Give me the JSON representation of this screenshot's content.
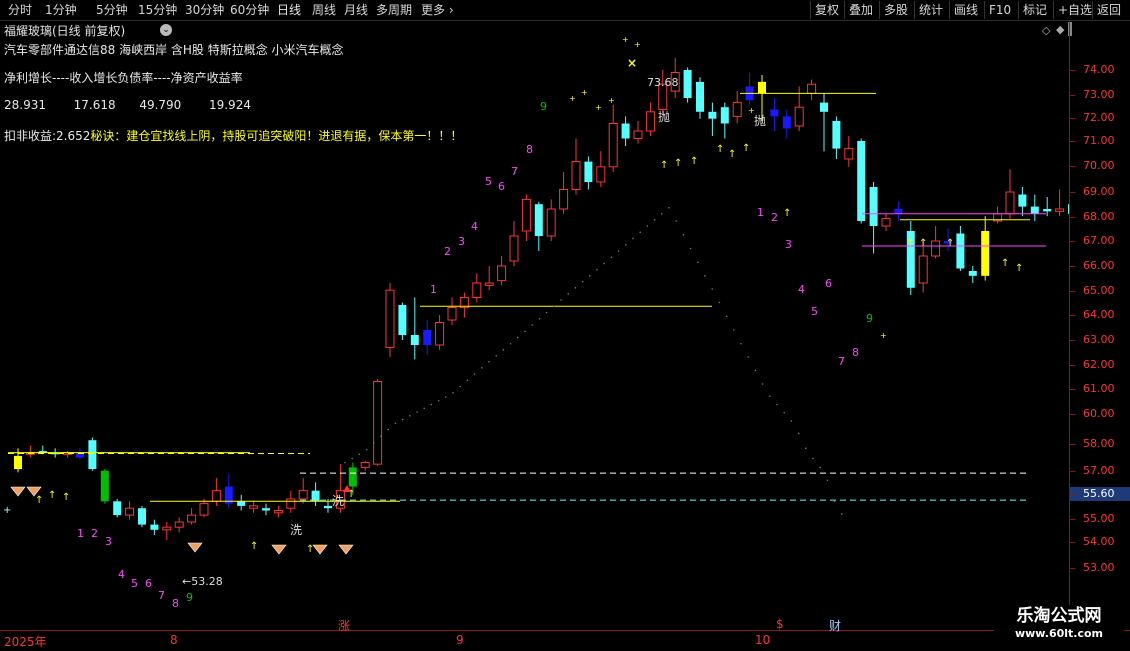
{
  "toolbar": {
    "periods": [
      "分时",
      "1分钟",
      "5分钟",
      "15分钟",
      "30分钟",
      "60分钟",
      "日线",
      "周线",
      "月线",
      "多周期",
      "更多"
    ],
    "active_period": "日线",
    "right_buttons": [
      "复权",
      "叠加",
      "多股",
      "统计",
      "画线",
      "F10",
      "标记",
      "+自选",
      "返回"
    ]
  },
  "header": {
    "title": "福耀玻璃(日线 前复权)",
    "concepts": "汽车零部件通达信88 海峡西岸 含H股 特斯拉概念 小米汽车概念",
    "metrics_label": "净利增长----收入增长负债率----净资产收益率",
    "metrics_values": [
      "28.931",
      "17.618",
      "49.790",
      "19.924"
    ],
    "deduct_label": "扣非收益:",
    "deduct_value": "2.652",
    "tip": "秘诀：建仓宜找线上阴，持股可追突破阳！进退有据，保本第一！！！"
  },
  "price_axis": {
    "ticks": [
      "74.00",
      "73.00",
      "72.00",
      "71.00",
      "70.00",
      "69.00",
      "68.00",
      "67.00",
      "66.00",
      "65.00",
      "64.00",
      "63.00",
      "62.00",
      "61.00",
      "60.00",
      "58.00",
      "57.00",
      "55.60",
      "55.00",
      "54.00",
      "53.00"
    ],
    "current": "55.60"
  },
  "annotations": {
    "high": "73.68",
    "low": "53.28",
    "sell1": "抛",
    "sell2": "抛",
    "wash": "洗",
    "wash2": "洗"
  },
  "date_axis": {
    "labels": [
      "2025年",
      "8",
      "9",
      "10"
    ],
    "markers": [
      "涨",
      "$",
      "财"
    ]
  },
  "watermark": {
    "name": "乐淘公式网",
    "url": "www.60lt.com"
  },
  "colors": {
    "up": "#ff3232",
    "down": "#54ffff",
    "blue": "#1a1aff",
    "yellow": "#ffff00",
    "green": "#00c000",
    "magenta": "#ff44ff",
    "axis": "#ff3232",
    "text": "#dddddd"
  }
}
